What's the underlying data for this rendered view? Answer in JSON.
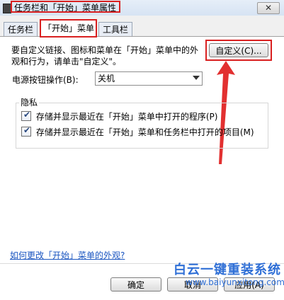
{
  "window": {
    "title": "任务栏和「开始」菜单属性",
    "close_label": "✕"
  },
  "tabs": [
    {
      "label": "任务栏",
      "active": false
    },
    {
      "label": "「开始」菜单",
      "active": true
    },
    {
      "label": "工具栏",
      "active": false
    }
  ],
  "start_menu": {
    "description": "要自定义链接、图标和菜单在「开始」菜单中的外观和行为，请单击\"自定义\"。",
    "customize_button": "自定义(C)...",
    "power_button_label": "电源按钮操作(B):",
    "power_button_value": "关机"
  },
  "privacy": {
    "group_title": "隐私",
    "store_programs": {
      "label": "存储并显示最近在「开始」菜单中打开的程序(P)",
      "checked": true
    },
    "store_items": {
      "label": "存储并显示最近在「开始」菜单和任务栏中打开的项目(M)",
      "checked": true
    }
  },
  "help_link": "如何更改「开始」菜单的外观?",
  "footer": {
    "ok_button": "确定",
    "cancel_button": "取消",
    "apply_button": "应用(A)"
  },
  "watermark": {
    "title": "白云一键重装系统",
    "url": "www.baiyunxitong.com"
  },
  "colors": {
    "annotation_red": "#d92020",
    "link_blue": "#1a55c0",
    "watermark_blue": "#2f6fd6"
  }
}
